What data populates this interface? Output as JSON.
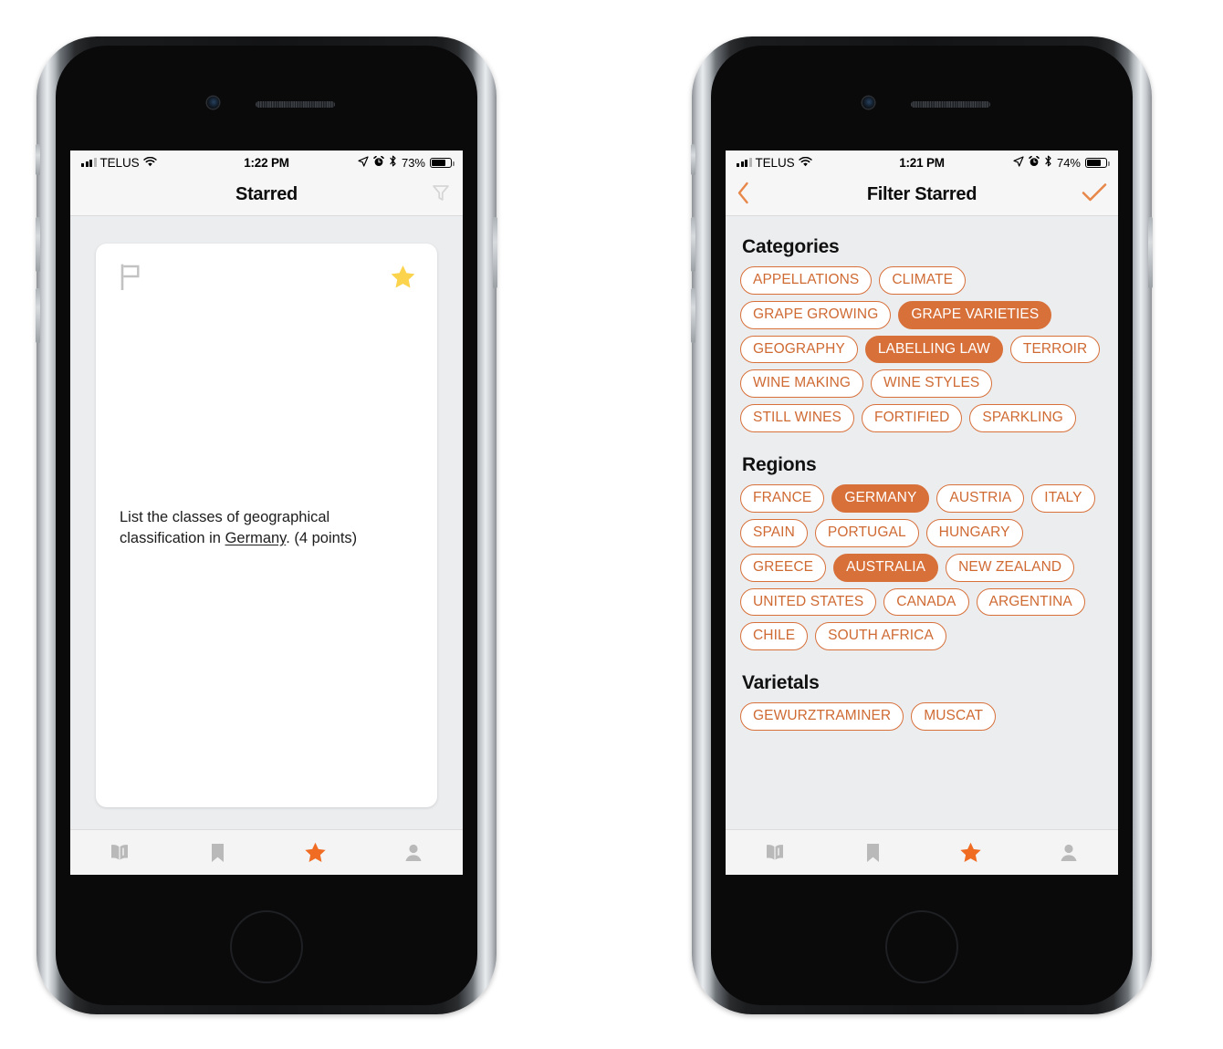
{
  "colors": {
    "accent_orange": "#d8703a",
    "chip_text_orange": "#cf6a33",
    "star_gold": "#fbd34d",
    "tab_inactive": "#b9b9b9",
    "screen_bg": "#ebedef"
  },
  "phones": [
    {
      "id": "starred-screen",
      "status_bar": {
        "carrier": "TELUS",
        "time": "1:22 PM",
        "battery_percent": "73%",
        "icons": [
          "signal-bars-icon",
          "wifi-icon",
          "location-arrow-icon",
          "alarm-clock-icon",
          "bluetooth-icon",
          "battery-icon"
        ]
      },
      "nav": {
        "title": "Starred",
        "right_icon": "filter-funnel-icon"
      },
      "card": {
        "flag_icon": "flag-outline-icon",
        "star_icon": "star-filled-icon",
        "question_prefix": "List the classes of geographical classification in ",
        "question_link": "Germany",
        "question_suffix": ". (4 points)"
      }
    },
    {
      "id": "filter-starred-screen",
      "status_bar": {
        "carrier": "TELUS",
        "time": "1:21 PM",
        "battery_percent": "74%",
        "icons": [
          "signal-bars-icon",
          "wifi-icon",
          "location-arrow-icon",
          "alarm-clock-icon",
          "bluetooth-icon",
          "battery-icon"
        ]
      },
      "nav": {
        "title": "Filter Starred",
        "left_icon": "back-chevron-icon",
        "right_icon": "checkmark-icon"
      },
      "sections": [
        {
          "title": "Categories",
          "chips": [
            {
              "label": "APPELLATIONS",
              "selected": false
            },
            {
              "label": "CLIMATE",
              "selected": false
            },
            {
              "label": "GRAPE GROWING",
              "selected": false
            },
            {
              "label": "GRAPE VARIETIES",
              "selected": true
            },
            {
              "label": "GEOGRAPHY",
              "selected": false
            },
            {
              "label": "LABELLING LAW",
              "selected": true
            },
            {
              "label": "TERROIR",
              "selected": false
            },
            {
              "label": "WINE MAKING",
              "selected": false
            },
            {
              "label": "WINE STYLES",
              "selected": false
            },
            {
              "label": "STILL WINES",
              "selected": false
            },
            {
              "label": "FORTIFIED",
              "selected": false
            },
            {
              "label": "SPARKLING",
              "selected": false
            }
          ]
        },
        {
          "title": "Regions",
          "chips": [
            {
              "label": "FRANCE",
              "selected": false
            },
            {
              "label": "GERMANY",
              "selected": true
            },
            {
              "label": "AUSTRIA",
              "selected": false
            },
            {
              "label": "ITALY",
              "selected": false
            },
            {
              "label": "SPAIN",
              "selected": false
            },
            {
              "label": "PORTUGAL",
              "selected": false
            },
            {
              "label": "HUNGARY",
              "selected": false
            },
            {
              "label": "GREECE",
              "selected": false
            },
            {
              "label": "AUSTRALIA",
              "selected": true
            },
            {
              "label": "NEW ZEALAND",
              "selected": false
            },
            {
              "label": "UNITED STATES",
              "selected": false
            },
            {
              "label": "CANADA",
              "selected": false
            },
            {
              "label": "ARGENTINA",
              "selected": false
            },
            {
              "label": "CHILE",
              "selected": false
            },
            {
              "label": "SOUTH AFRICA",
              "selected": false
            }
          ]
        },
        {
          "title": "Varietals",
          "chips": [
            {
              "label": "GEWURZTRAMINER",
              "selected": false
            },
            {
              "label": "MUSCAT",
              "selected": false
            }
          ]
        }
      ]
    }
  ],
  "tab_bar": {
    "tabs": [
      {
        "name": "book-icon",
        "label": "Book",
        "active": false
      },
      {
        "name": "bookmark-icon",
        "label": "Bookmark",
        "active": false
      },
      {
        "name": "star-icon",
        "label": "Starred",
        "active": true
      },
      {
        "name": "person-icon",
        "label": "Profile",
        "active": false
      }
    ]
  }
}
